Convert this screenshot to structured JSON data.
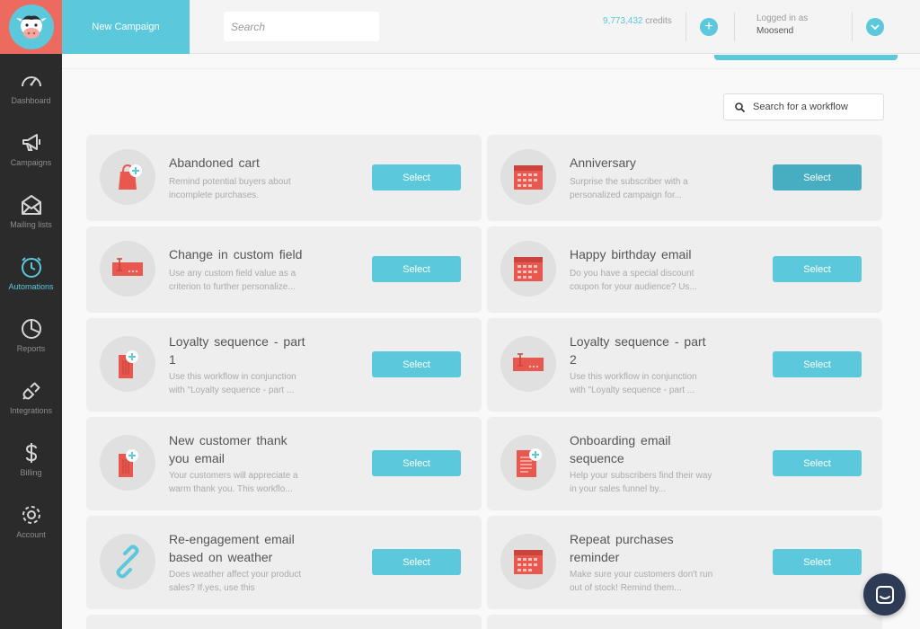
{
  "header": {
    "new_campaign": "New Campaign",
    "search_placeholder": "Search",
    "credits_value": "9,773,432",
    "credits_unit": "credits",
    "logged_in_label": "Logged in as",
    "username": "Moosend"
  },
  "sidebar": {
    "items": [
      {
        "label": "Dashboard",
        "icon": "gauge-icon"
      },
      {
        "label": "Campaigns",
        "icon": "megaphone-icon"
      },
      {
        "label": "Mailing lists",
        "icon": "envelope-icon"
      },
      {
        "label": "Automations",
        "icon": "clock-icon",
        "active": true
      },
      {
        "label": "Reports",
        "icon": "pie-chart-icon"
      },
      {
        "label": "Integrations",
        "icon": "plug-icon"
      },
      {
        "label": "Billing",
        "icon": "dollar-icon"
      },
      {
        "label": "Account",
        "icon": "gear-icon"
      }
    ]
  },
  "main": {
    "workflow_search": "Search for a workflow",
    "select_label": "Select",
    "workflows": [
      {
        "title": "Abandoned cart",
        "desc": "Remind potential buyers about incomplete purchases.",
        "icon": "shopping-bag-icon"
      },
      {
        "title": "Anniversary",
        "desc": "Surprise the subscriber with a personalized campaign for...",
        "icon": "calendar-icon"
      },
      {
        "title": "Change in custom field",
        "desc": "Use any custom field value as a criterion to further personalize...",
        "icon": "text-field-icon"
      },
      {
        "title": "Happy birthday email",
        "desc": "Do you have a special discount coupon for your audience? Us...",
        "icon": "calendar-icon"
      },
      {
        "title": "Loyalty sequence - part 1",
        "desc": "Use this workflow in conjunction with \"Loyalty sequence - part ...",
        "icon": "price-tag-icon"
      },
      {
        "title": "Loyalty sequence - part 2",
        "desc": "Use this workflow in conjunction with \"Loyalty sequence - part ...",
        "icon": "text-field-icon"
      },
      {
        "title": "New customer thank you email",
        "desc": "Your customers will appreciate a warm thank you. This workflo...",
        "icon": "price-tag-icon"
      },
      {
        "title": "Onboarding email sequence",
        "desc": "Help your subscribers find their way in your sales funnel by...",
        "icon": "document-icon"
      },
      {
        "title": "Re-engagement email based on weather",
        "desc": "Does weather affect your product sales? If.yes, use this",
        "icon": "link-icon"
      },
      {
        "title": "Repeat purchases reminder",
        "desc": "Make sure your customers don't run out of stock! Remind them...",
        "icon": "calendar-icon"
      }
    ]
  },
  "colors": {
    "accent": "#5bc8dc",
    "brand_red": "#ec6b5e",
    "icon_red": "#e8584f",
    "sidebar_bg": "#2b2b2b"
  }
}
